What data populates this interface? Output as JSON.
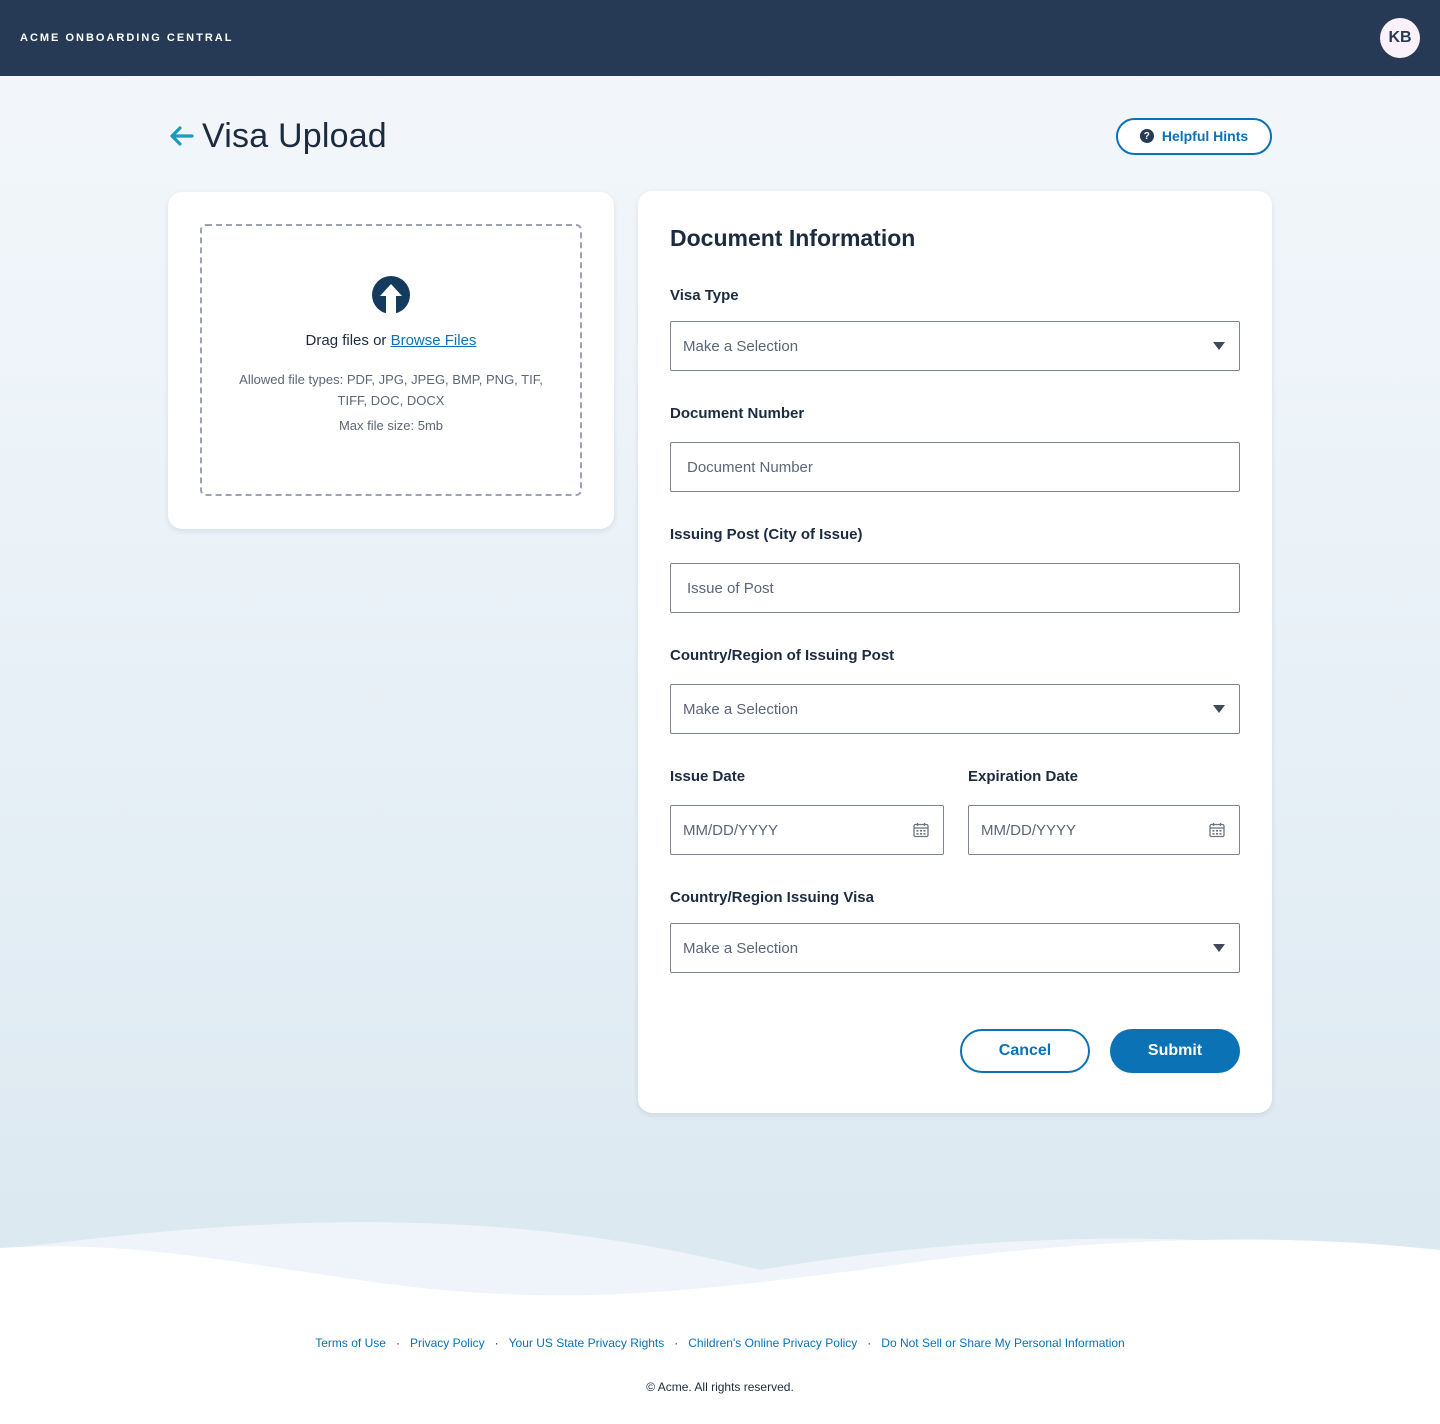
{
  "header": {
    "brand": "ACME ONBOARDING CENTRAL",
    "avatar_initials": "KB"
  },
  "page": {
    "title": "Visa Upload",
    "hints_label": "Helpful Hints"
  },
  "upload": {
    "drag_text": "Drag files or ",
    "browse_link": "Browse Files",
    "allowed_types": "Allowed file types: PDF, JPG, JPEG, BMP, PNG, TIF, TIFF, DOC, DOCX",
    "max_size": "Max file size: 5mb"
  },
  "form": {
    "title": "Document Information",
    "visa_type": {
      "label": "Visa Type",
      "value": "Make a Selection"
    },
    "document_number": {
      "label": "Document Number",
      "placeholder": "Document Number"
    },
    "issuing_post": {
      "label": "Issuing Post (City of Issue)",
      "placeholder": "Issue of Post"
    },
    "country_issuing_post": {
      "label": "Country/Region of Issuing Post",
      "value": "Make a Selection"
    },
    "issue_date": {
      "label": "Issue Date",
      "placeholder": "MM/DD/YYYY"
    },
    "expiration_date": {
      "label": "Expiration Date",
      "placeholder": "MM/DD/YYYY"
    },
    "country_issuing_visa": {
      "label": "Country/Region Issuing Visa",
      "value": "Make a Selection"
    },
    "cancel_label": "Cancel",
    "submit_label": "Submit"
  },
  "footer": {
    "links": [
      "Terms of Use",
      "Privacy Policy",
      "Your US State Privacy Rights",
      "Children's Online Privacy Policy",
      "Do Not Sell or Share My Personal Information"
    ],
    "copyright": "© Acme. All rights reserved."
  },
  "colors": {
    "topbar": "#263a55",
    "accent": "#0a72b5",
    "back_arrow": "#1b9ac0"
  },
  "icons": [
    "back-arrow-icon",
    "help-icon",
    "upload-arrow-icon",
    "caret-down-icon",
    "calendar-icon"
  ]
}
